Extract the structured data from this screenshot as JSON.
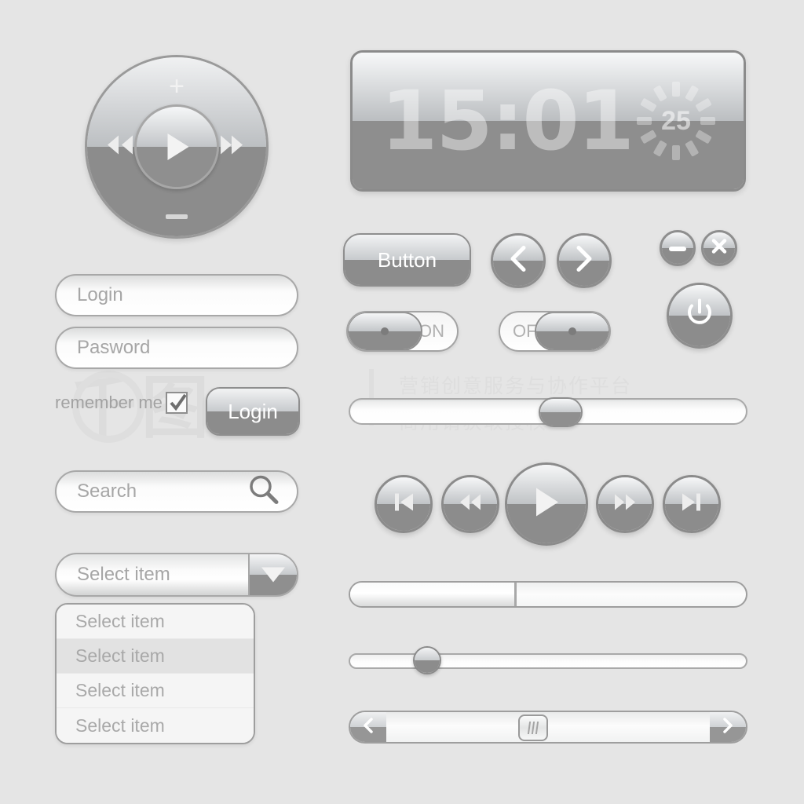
{
  "theme": {
    "background": "#e5e5e5",
    "accent_light": "#f6f7f8",
    "accent_dark": "#8c8c8c",
    "border": "#8e8e8e",
    "text_muted": "#a6a6a6",
    "text_on_dark": "#ffffff"
  },
  "watermark": {
    "logo_text": "千图",
    "line1": "营销创意服务与协作平台",
    "line2": "商用请获取授权"
  },
  "dpad": {
    "name": "circular-media-pad",
    "volume_up_label": "+",
    "volume_down_label": "−",
    "prev_icon": "rewind-icon",
    "next_icon": "fast-forward-icon",
    "center_icon": "play-icon"
  },
  "clock": {
    "time": "15:01",
    "spinner_value": "25",
    "spinner_segments": 12
  },
  "login_form": {
    "login_placeholder": "Login",
    "password_placeholder": "Pasword",
    "remember_label": "remember me",
    "remember_checked": true,
    "submit_label": "Login"
  },
  "search": {
    "placeholder": "Search",
    "icon": "search-icon"
  },
  "select": {
    "selected_label": "Select item",
    "arrow_icon": "chevron-down-icon",
    "options": [
      {
        "label": "Select item",
        "hover": false
      },
      {
        "label": "Select item",
        "hover": true
      },
      {
        "label": "Select item",
        "hover": false
      },
      {
        "label": "Select item",
        "hover": false
      }
    ]
  },
  "buttons": {
    "primary_label": "Button",
    "nav_prev_icon": "chevron-left-icon",
    "nav_next_icon": "chevron-right-icon",
    "minimize_icon": "minus-icon",
    "close_icon": "close-icon",
    "power_icon": "power-icon"
  },
  "toggles": [
    {
      "name": "toggle-on",
      "label": "ON",
      "state": "on"
    },
    {
      "name": "toggle-off",
      "label": "OFF",
      "state": "off"
    }
  ],
  "volume_slider": {
    "name": "volume-slider",
    "value_percent": 53
  },
  "transport": {
    "first_icon": "skip-to-start-icon",
    "rewind_icon": "rewind-icon",
    "play_icon": "play-icon",
    "forward_icon": "fast-forward-icon",
    "last_icon": "skip-to-end-icon"
  },
  "progress_bar": {
    "name": "progress-bar",
    "value_percent": 42
  },
  "thin_slider": {
    "name": "range-slider",
    "value_percent": 17
  },
  "scrollbar": {
    "left_icon": "chevron-left-icon",
    "right_icon": "chevron-right-icon",
    "thumb_position_percent": 45,
    "grip_lines": 3
  }
}
